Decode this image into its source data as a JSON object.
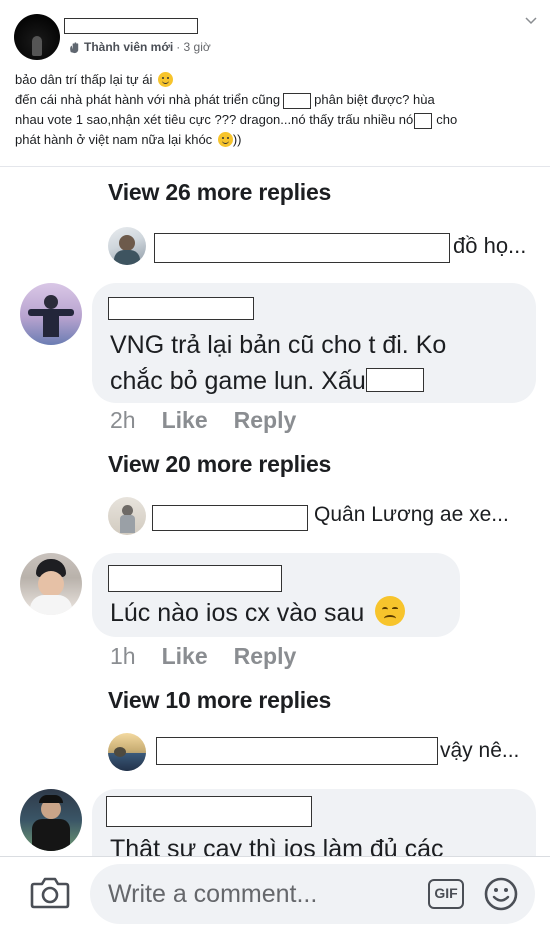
{
  "post": {
    "author_role": "Thành viên mới",
    "time": "· 3 giờ",
    "lines": [
      "bảo dân trí thấp lại tự ái",
      "đến cái nhà phát hành với nhà phát triển cũng",
      "phân biệt được? hùa",
      "nhau vote 1 sao,nhận xét tiêu cực ??? dragon...nó thấy trấu nhiều nó",
      "cho",
      "phát hành ở việt nam nữa lại khóc",
      "))"
    ]
  },
  "thread": {
    "blocks": [
      {
        "view_more": "View 26 more replies",
        "reply_preview": "đồ họ..."
      },
      {
        "comment_lines": [
          "VNG trả lại bản cũ cho t đi. Ko",
          "chắc bỏ game lun. Xấu"
        ],
        "time": "2h",
        "like": "Like",
        "reply": "Reply",
        "view_more": "View 20 more replies",
        "reply_preview": "Quân Lương  ae xe..."
      },
      {
        "comment_lines": [
          "Lúc nào ios cx vào sau"
        ],
        "time": "1h",
        "like": "Like",
        "reply": "Reply",
        "view_more": "View 10 more replies",
        "reply_preview": "vậy nê..."
      },
      {
        "comment_lines": [
          "Thật sự cay thì ios làm đủ các"
        ]
      }
    ]
  },
  "composer": {
    "placeholder": "Write a comment...",
    "gif_label": "GIF"
  },
  "icons": {
    "camera": "camera-icon",
    "gif": "gif-icon",
    "emoji": "smiley-icon",
    "chevron": "chevron-down-icon",
    "role_badge": "new-member-hand-icon"
  }
}
